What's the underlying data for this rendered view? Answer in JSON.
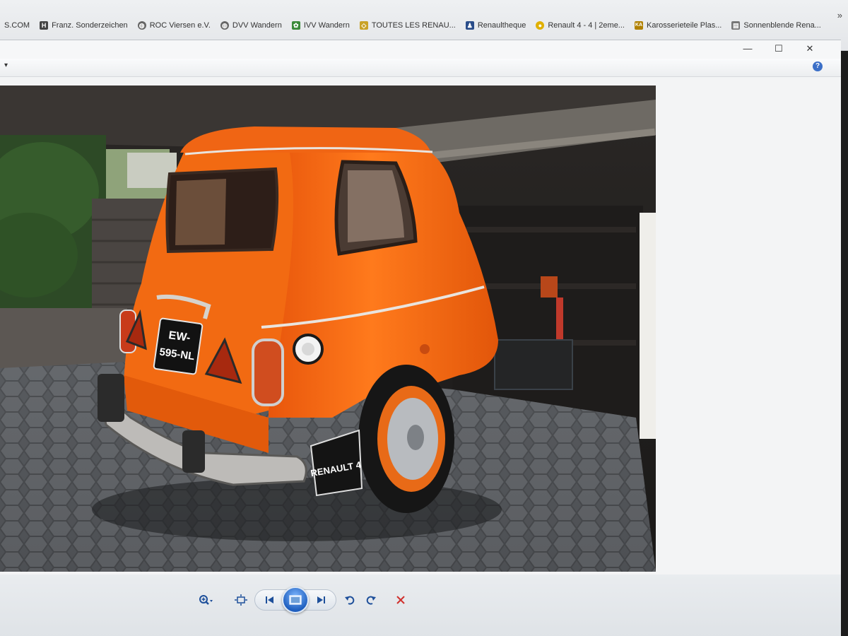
{
  "bookmarks": [
    {
      "label": "S.COM",
      "icon": "none",
      "color": ""
    },
    {
      "label": "Franz. Sonderzeichen",
      "icon": "h-icon",
      "color": "#444444"
    },
    {
      "label": "ROC Viersen e.V.",
      "icon": "globe-icon",
      "color": "#666666"
    },
    {
      "label": "DVV Wandern",
      "icon": "globe-icon",
      "color": "#666666"
    },
    {
      "label": "IVV Wandern",
      "icon": "ivv-icon",
      "color": "#3a8a3a"
    },
    {
      "label": "TOUTES LES RENAU...",
      "icon": "renault-icon",
      "color": "#c9a227"
    },
    {
      "label": "Renaultheque",
      "icon": "person-icon",
      "color": "#2a4d8a"
    },
    {
      "label": "Renault 4 - 4 | 2eme...",
      "icon": "circle-icon",
      "color": "#e0b000"
    },
    {
      "label": "Karosserieteile Plas...",
      "icon": "ka-icon",
      "color": "#b08000"
    },
    {
      "label": "Sonnenblende Rena...",
      "icon": "page-icon",
      "color": "#777777"
    }
  ],
  "overflow_glyph": "»",
  "window": {
    "minimize": "—",
    "maximize": "☐",
    "close": "✕",
    "help": "?",
    "menu_arrow": "▾"
  },
  "photo": {
    "plate_line1": "EW-",
    "plate_line2": "595-NL",
    "mudflap": "RENAULT 4",
    "accent_color": "#f26a12"
  },
  "toolbar": {
    "zoom": "zoom-icon",
    "fit": "fit-window-icon",
    "prev": "previous-icon",
    "slideshow": "slideshow-icon",
    "next": "next-icon",
    "rotate_ccw": "rotate-left-icon",
    "rotate_cw": "rotate-right-icon",
    "delete": "delete-icon"
  }
}
